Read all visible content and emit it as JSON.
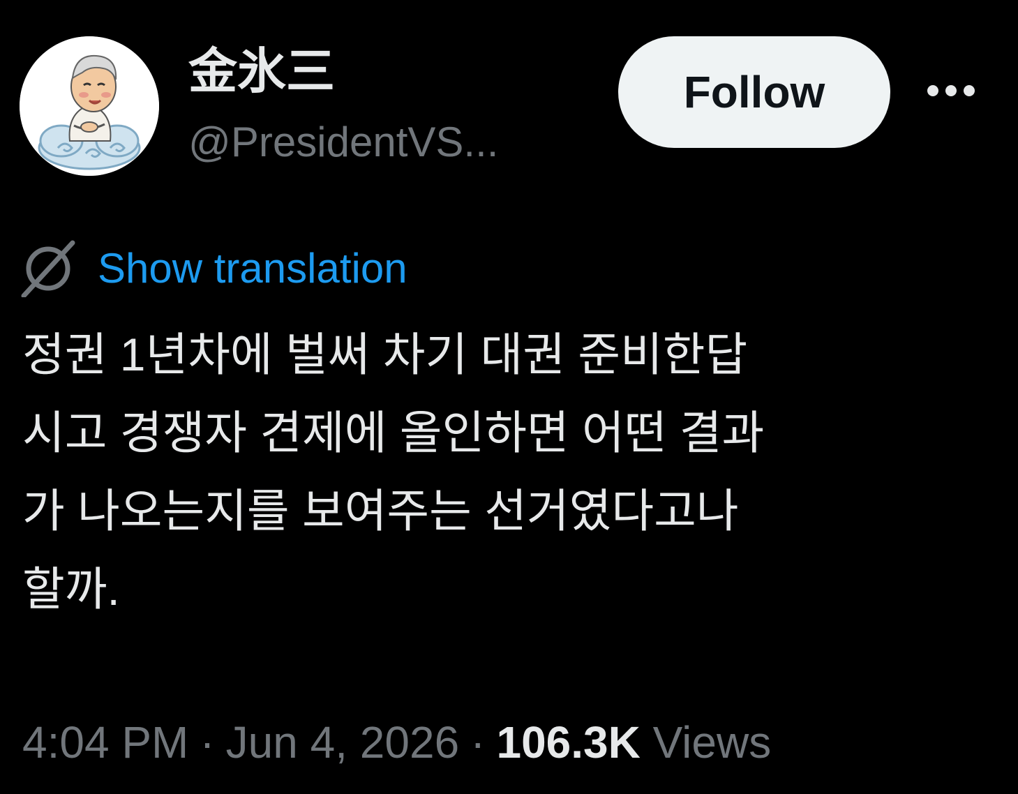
{
  "author": {
    "display_name": "金氷三",
    "handle": "@PresidentVS..."
  },
  "actions": {
    "follow_label": "Follow",
    "more_icon": "ellipsis-icon"
  },
  "translation": {
    "icon": "globe-icon",
    "label": "Show translation"
  },
  "tweet": {
    "lines": [
      "정권 1년차에 벌써 차기 대권 준비한답",
      "시고 경쟁자 견제에 올인하면 어떤 결과",
      "가 나오는지를 보여주는 선거였다고나",
      "할까."
    ]
  },
  "meta": {
    "time": "4:04 PM",
    "separator": "·",
    "date": "Jun 4, 2026",
    "views_count": "106.3K",
    "views_label": "Views"
  },
  "colors": {
    "background": "#000000",
    "text_primary": "#e7e9ea",
    "text_secondary": "#71767b",
    "accent": "#1d9bf0",
    "follow_bg": "#eff3f4"
  }
}
